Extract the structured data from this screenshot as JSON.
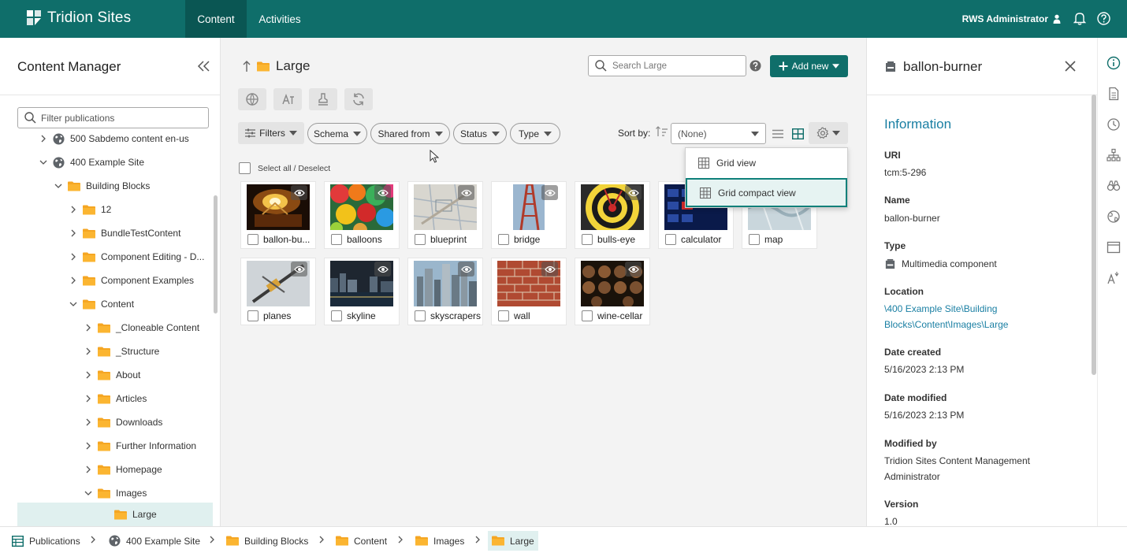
{
  "topbar": {
    "app_name": "Tridion Sites",
    "tabs": [
      {
        "label": "Content",
        "active": true
      },
      {
        "label": "Activities",
        "active": false
      }
    ],
    "user": "RWS Administrator",
    "icons": [
      "user-icon",
      "bell-icon",
      "help-circle-icon"
    ]
  },
  "left_panel": {
    "title": "Content Manager",
    "filter_placeholder": "Filter publications",
    "tree": [
      {
        "label": "500 Sabdemo content en-us",
        "expanded": false,
        "icon": "globe-icon"
      },
      {
        "label": "400 Example Site",
        "expanded": true,
        "icon": "globe-icon"
      },
      {
        "label": "Building Blocks",
        "expanded": true,
        "icon": "folder-icon"
      },
      {
        "label": "12",
        "expanded": false,
        "icon": "folder-icon"
      },
      {
        "label": "BundleTestContent",
        "expanded": false,
        "icon": "folder-icon"
      },
      {
        "label": "Component Editing - D...",
        "expanded": false,
        "icon": "folder-icon"
      },
      {
        "label": "Component Examples",
        "expanded": false,
        "icon": "folder-icon"
      },
      {
        "label": "Content",
        "expanded": true,
        "icon": "folder-icon"
      },
      {
        "label": "_Cloneable Content",
        "expanded": false,
        "icon": "folder-icon"
      },
      {
        "label": "_Structure",
        "expanded": false,
        "icon": "folder-icon"
      },
      {
        "label": "About",
        "expanded": false,
        "icon": "folder-icon"
      },
      {
        "label": "Articles",
        "expanded": false,
        "icon": "folder-icon"
      },
      {
        "label": "Downloads",
        "expanded": false,
        "icon": "folder-icon"
      },
      {
        "label": "Further Information",
        "expanded": false,
        "icon": "folder-icon"
      },
      {
        "label": "Homepage",
        "expanded": false,
        "icon": "folder-icon"
      },
      {
        "label": "Images",
        "expanded": true,
        "icon": "folder-icon"
      },
      {
        "label": "Large",
        "expanded": false,
        "icon": "folder-icon",
        "selected": true
      }
    ]
  },
  "center": {
    "title": "Large",
    "search_placeholder": "Search Large",
    "add_new_label": "Add new",
    "filters_label": "Filters",
    "chips": [
      "Schema",
      "Shared from",
      "Status",
      "Type"
    ],
    "sort_label": "Sort by:",
    "sort_value": "(None)",
    "select_all_label": "Select all / Deselect",
    "items": [
      {
        "label": "ballon-bu..."
      },
      {
        "label": "balloons"
      },
      {
        "label": "blueprint"
      },
      {
        "label": "bridge"
      },
      {
        "label": "bulls-eye"
      },
      {
        "label": "calculator"
      },
      {
        "label": "map"
      },
      {
        "label": "planes"
      },
      {
        "label": "skyline"
      },
      {
        "label": "skyscrapers"
      },
      {
        "label": "wall"
      },
      {
        "label": "wine-cellar"
      }
    ],
    "view_menu": [
      {
        "label": "Grid view"
      },
      {
        "label": "Grid compact view",
        "highlighted": true
      }
    ]
  },
  "right_panel": {
    "title": "ballon-burner",
    "section": "Information",
    "fields": {
      "uri_label": "URI",
      "uri": "tcm:5-296",
      "name_label": "Name",
      "name": "ballon-burner",
      "type_label": "Type",
      "type": "Multimedia component",
      "location_label": "Location",
      "location": "\\400 Example Site\\Building Blocks\\Content\\Images\\Large",
      "created_label": "Date created",
      "created": "5/16/2023 2:13 PM",
      "modified_label": "Date modified",
      "modified": "5/16/2023 2:13 PM",
      "modified_by_label": "Modified by",
      "modified_by": "Tridion Sites Content Management Administrator",
      "version_label": "Version",
      "version": "1.0"
    }
  },
  "breadcrumb": [
    {
      "label": "Publications",
      "icon": "publications-icon"
    },
    {
      "label": "400 Example Site",
      "icon": "globe-icon"
    },
    {
      "label": "Building Blocks",
      "icon": "folder-icon"
    },
    {
      "label": "Content",
      "icon": "folder-icon"
    },
    {
      "label": "Images",
      "icon": "folder-icon"
    },
    {
      "label": "Large",
      "icon": "folder-icon",
      "active": true
    }
  ],
  "colors": {
    "brand": "#0f6e6a",
    "link": "#1a7fa3",
    "folder": "#f5a623",
    "selection": "#e0f0ef"
  }
}
